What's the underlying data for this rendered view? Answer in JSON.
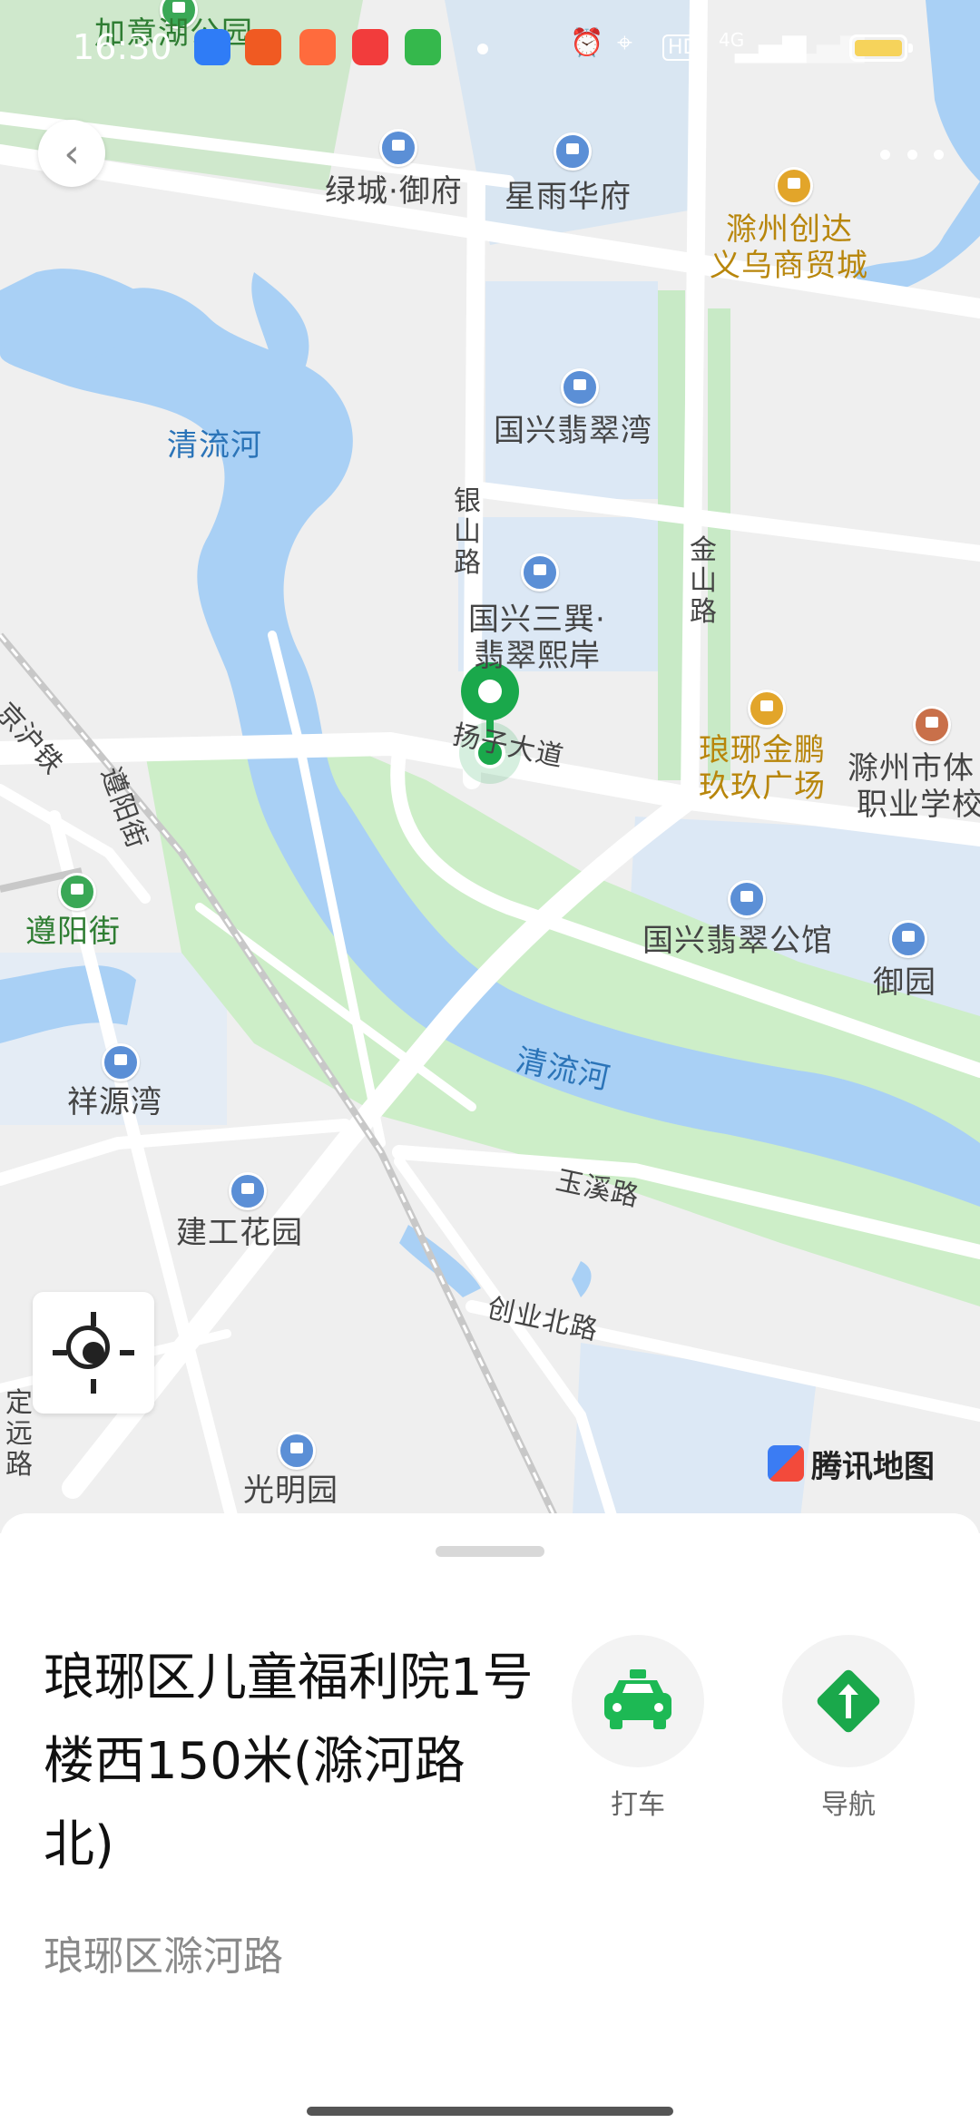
{
  "status_bar": {
    "time": "16:30",
    "hd_label": "HD",
    "network_label": "4G"
  },
  "map": {
    "labels": {
      "jiazhang_park": "加意湖公园",
      "lvcheng_yufu": "绿城·御府",
      "xingyu_huafu": "星雨华府",
      "chuangda_line1": "滁州创达",
      "chuangda_line2": "义乌商贸城",
      "qingliu_river_top": "清流河",
      "guoxing_feicuiwan": "国兴翡翠湾",
      "yinshan_road": "银山路",
      "jinshan_road": "金山路",
      "sanxun_line1": "国兴三巽·",
      "sanxun_line2": "翡翠熙岸",
      "yangzi_avenue": "扬子大道",
      "langya_jinpeng_line1": "琅琊金鹏",
      "langya_jinpeng_line2": "玖玖广场",
      "vocational_line1": "滁州市体",
      "vocational_line2": "职业学校",
      "jinghu_rail": "京沪铁",
      "zunyang_street_road": "遵阳街",
      "zunyang_street_station": "遵阳街",
      "guoxing_gongguan": "国兴翡翠公馆",
      "yuyuan": "御园",
      "xiangyuanwan": "祥源湾",
      "qingliu_river_mid": "清流河",
      "yuxi_road": "玉溪路",
      "jiangong_garden": "建工花园",
      "chuangye_north_road": "创业北路",
      "dingyuan_road": "定远路",
      "guangming_garden": "光明园"
    },
    "brand": "腾讯地图"
  },
  "sheet": {
    "title": "琅琊区儿童福利院1号楼西150米(滁河路北)",
    "subtitle": "琅琊区滁河路",
    "actions": [
      {
        "label": "打车",
        "icon": "taxi-icon",
        "color": "#1db954"
      },
      {
        "label": "导航",
        "icon": "navigation-icon",
        "color": "#1aa84b"
      }
    ]
  },
  "colors": {
    "accent": "#1aa84b",
    "water": "#a9d0f5",
    "park": "#cdeec8",
    "residential": "#dce8f5"
  }
}
